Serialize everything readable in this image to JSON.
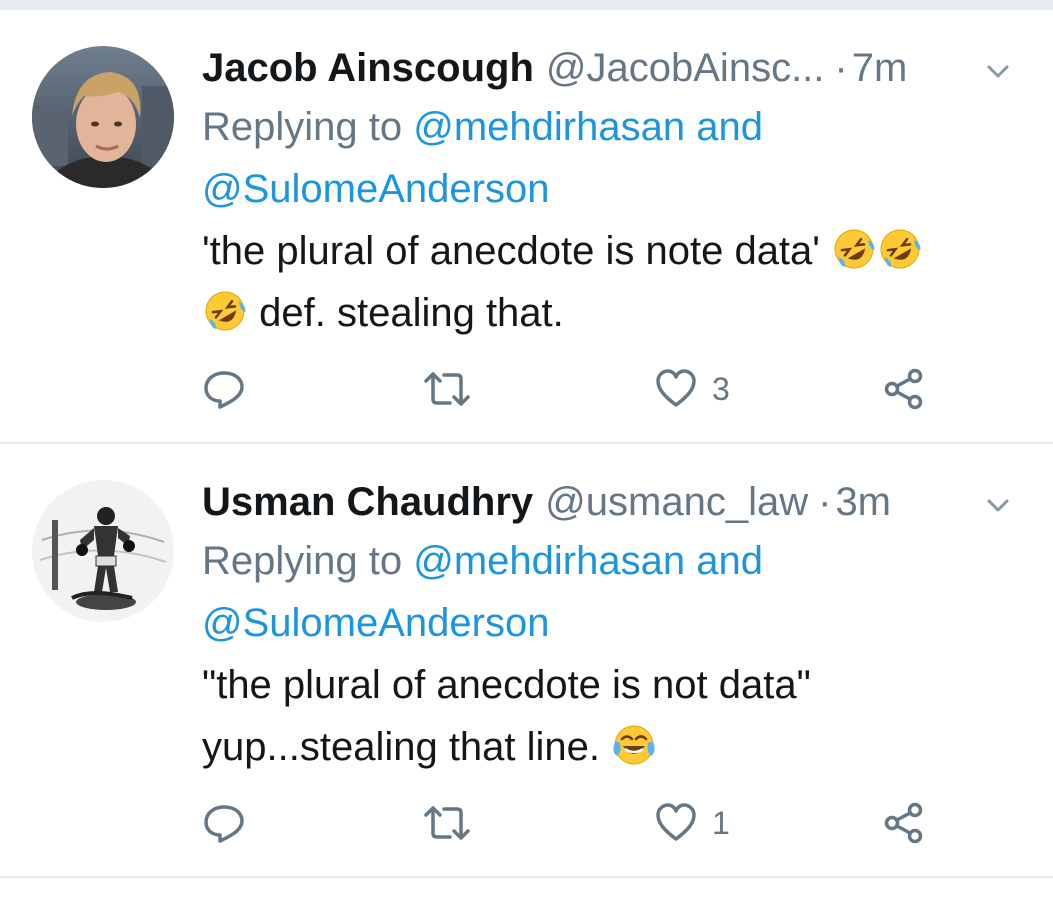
{
  "tweets": [
    {
      "author_name": "Jacob Ainscough",
      "author_handle": "@JacobAinsc...",
      "separator": "·",
      "time": "7m",
      "replying_prefix": "Replying to",
      "reply_mention_1": "@mehdirhasan and",
      "reply_mention_2": "@SulomeAnderson",
      "text_line_1": "'the plural of anecdote is note data'",
      "text_line_2": "def. stealing that.",
      "emojis": [
        "rolling-on-floor-laughing",
        "rolling-on-floor-laughing",
        "rolling-on-floor-laughing"
      ],
      "like_count": "3"
    },
    {
      "author_name": "Usman Chaudhry",
      "author_handle": "@usmanc_law",
      "separator": "·",
      "time": "3m",
      "replying_prefix": "Replying to",
      "reply_mention_1": "@mehdirhasan and",
      "reply_mention_2": "@SulomeAnderson",
      "text_line_1": "\"the plural of anecdote is not data\"",
      "text_line_2": "yup...stealing that line.",
      "emojis": [
        "face-with-tears-of-joy"
      ],
      "like_count": "1"
    }
  ],
  "colors": {
    "text": "#14171a",
    "secondary": "#657786",
    "link": "#1b95e0",
    "divider": "#e6ecf0"
  },
  "icons": [
    "reply-icon",
    "retweet-icon",
    "like-icon",
    "share-icon",
    "chevron-down-icon"
  ]
}
